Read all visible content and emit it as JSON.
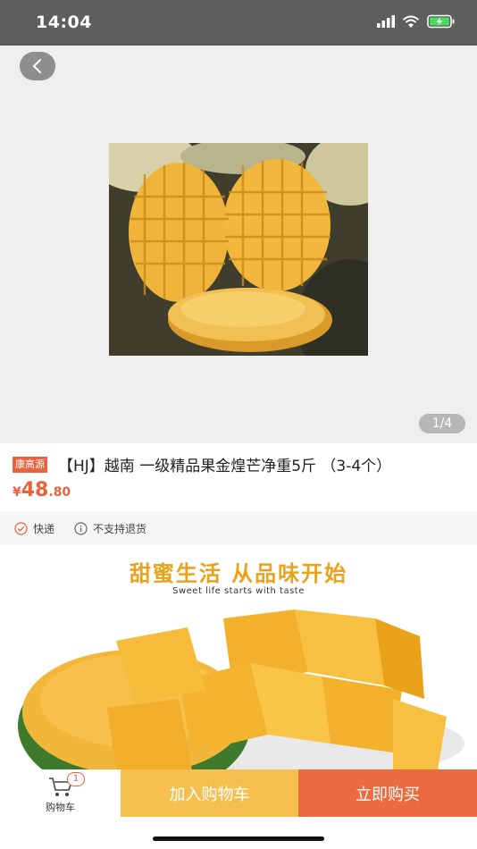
{
  "status_bar": {
    "time": "14:04"
  },
  "gallery": {
    "page_indicator": "1/4"
  },
  "product": {
    "brand_badge": "康高源",
    "title": "【HJ】越南 一级精品果金煌芒净重5斤 （3-4个）",
    "price_currency": "¥",
    "price_integer": "48",
    "price_decimal": ".80"
  },
  "services": [
    {
      "label": "快递",
      "icon": "check-circle-icon"
    },
    {
      "label": "不支持退货",
      "icon": "info-circle-icon"
    }
  ],
  "detail": {
    "slogan": "甜蜜生活  从品味开始",
    "subtitle": "Sweet life starts with taste"
  },
  "bottom_bar": {
    "cart_label": "购物车",
    "cart_count": "1",
    "add_to_cart": "加入购物车",
    "buy_now": "立即购买"
  },
  "colors": {
    "accent": "#e8623e",
    "add_cart": "#f5c04f",
    "buy": "#ea6b3f",
    "slogan": "#e9a21a"
  }
}
